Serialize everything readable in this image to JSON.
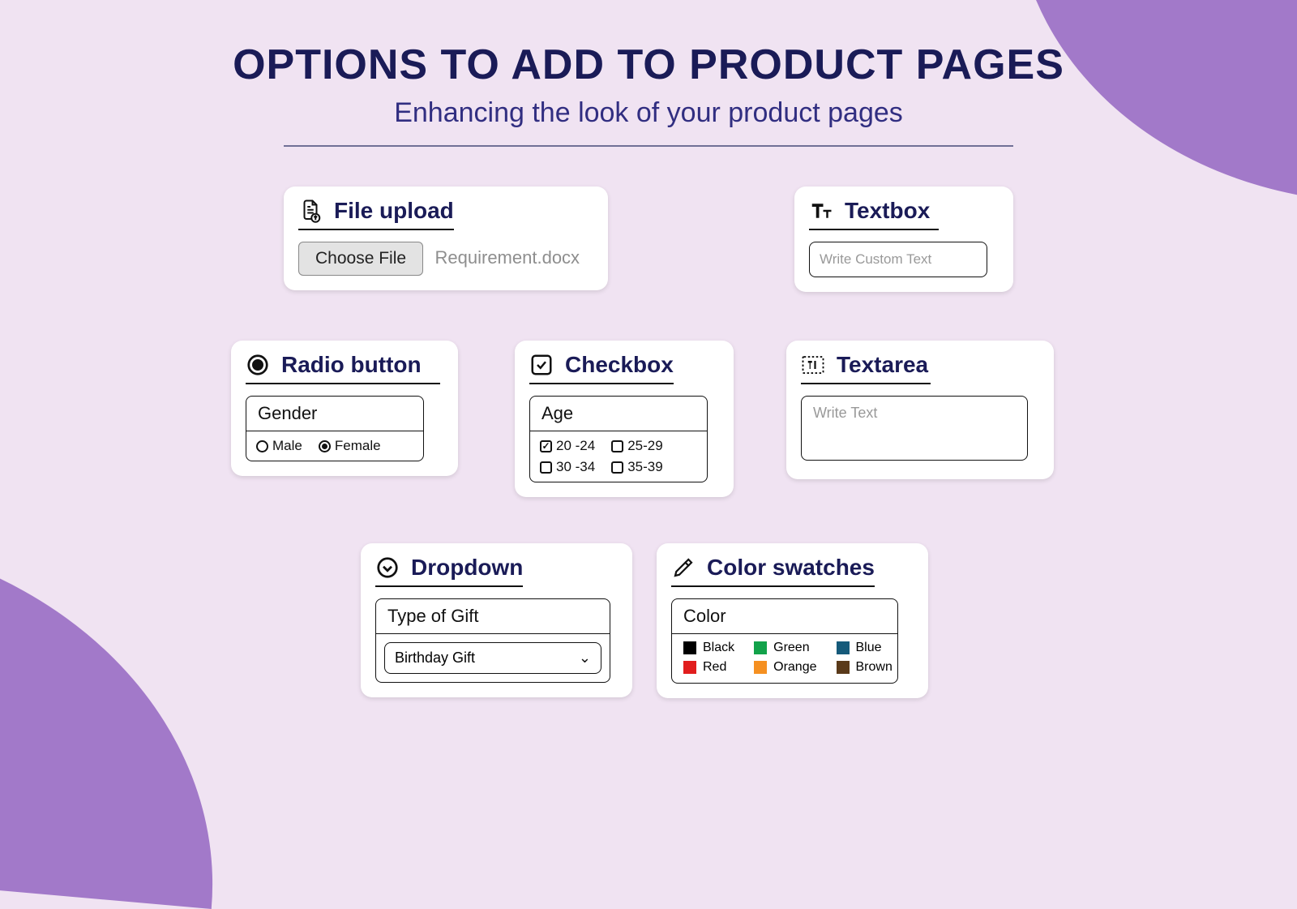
{
  "header": {
    "title": "OPTIONS TO ADD TO PRODUCT PAGES",
    "subtitle": "Enhancing the look of your product pages"
  },
  "cards": {
    "file_upload": {
      "title": "File upload",
      "button_label": "Choose File",
      "file_name": "Requirement.docx"
    },
    "textbox": {
      "title": "Textbox",
      "placeholder": "Write Custom Text"
    },
    "radio": {
      "title": "Radio button",
      "panel_title": "Gender",
      "options": [
        {
          "label": "Male",
          "checked": false
        },
        {
          "label": "Female",
          "checked": true
        }
      ]
    },
    "checkbox": {
      "title": "Checkbox",
      "panel_title": "Age",
      "options": [
        {
          "label": "20 -24",
          "checked": true
        },
        {
          "label": "25-29",
          "checked": false
        },
        {
          "label": "30 -34",
          "checked": false
        },
        {
          "label": "35-39",
          "checked": false
        }
      ]
    },
    "textarea": {
      "title": "Textarea",
      "placeholder": "Write Text"
    },
    "dropdown": {
      "title": "Dropdown",
      "panel_title": "Type of Gift",
      "selected": "Birthday Gift"
    },
    "color": {
      "title": "Color swatches",
      "panel_title": "Color",
      "swatches": [
        {
          "label": "Black",
          "hex": "#000000"
        },
        {
          "label": "Green",
          "hex": "#12a24a"
        },
        {
          "label": "Blue",
          "hex": "#155a7a"
        },
        {
          "label": "Red",
          "hex": "#e11d1d"
        },
        {
          "label": "Orange",
          "hex": "#f59021"
        },
        {
          "label": "Brown",
          "hex": "#5a3a1a"
        }
      ]
    }
  }
}
